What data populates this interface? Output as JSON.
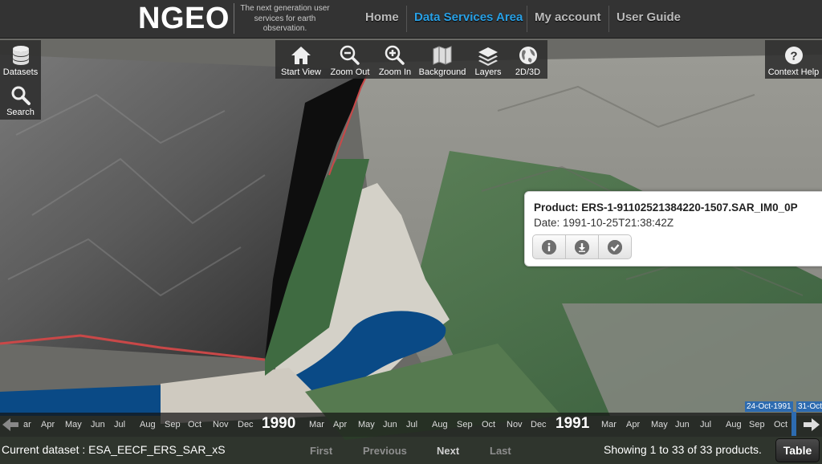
{
  "header": {
    "logo": "NGEO",
    "tagline": "The next generation user services for earth observation.",
    "nav": [
      {
        "label": "Home",
        "icon": "home"
      },
      {
        "label": "Data Services Area",
        "active": true
      },
      {
        "label": "My account"
      },
      {
        "label": "User Guide"
      }
    ]
  },
  "left_toolbar": [
    {
      "label": "Datasets",
      "icon": "database-icon"
    },
    {
      "label": "Search",
      "icon": "search-icon"
    }
  ],
  "map_toolbar": [
    {
      "label": "Start View",
      "icon": "home-icon"
    },
    {
      "label": "Zoom Out",
      "icon": "zoom-out-icon"
    },
    {
      "label": "Zoom In",
      "icon": "zoom-in-icon"
    },
    {
      "label": "Background",
      "icon": "map-icon"
    },
    {
      "label": "Layers",
      "icon": "layers-icon"
    },
    {
      "label": "2D/3D",
      "icon": "globe-icon"
    }
  ],
  "help": {
    "label": "Context Help",
    "icon": "help-icon"
  },
  "popup": {
    "product": "Product: ERS-1-91102521384220-1507.SAR_IM0_0P",
    "date": "Date: 1991-10-25T21:38:42Z",
    "actions": [
      {
        "name": "info",
        "icon": "info-icon"
      },
      {
        "name": "download",
        "icon": "download-icon"
      },
      {
        "name": "select",
        "icon": "check-icon"
      }
    ]
  },
  "timeline": {
    "labels": [
      "ar",
      "Apr",
      "May",
      "Jun",
      "Jul",
      "Aug",
      "Sep",
      "Oct",
      "Nov",
      "Dec",
      "1990",
      "Mar",
      "Apr",
      "May",
      "Jun",
      "Jul",
      "Aug",
      "Sep",
      "Oct",
      "Nov",
      "Dec",
      "1991",
      "Mar",
      "Apr",
      "May",
      "Jun",
      "Jul",
      "Aug",
      "Sep",
      "Oct"
    ],
    "range_start": "24-Oct-1991",
    "range_end": "31-Oct",
    "accent": "#2d6bb0"
  },
  "status": {
    "current_dataset": "Current dataset : ESA_EECF_ERS_SAR_xS",
    "pager": {
      "first": "First",
      "previous": "Previous",
      "next": "Next",
      "last": "Last"
    },
    "showing": "Showing 1 to 33 of 33 products.",
    "table_label": "Table"
  },
  "colors": {
    "header_bg": "#333333",
    "active_nav": "#29a1e6",
    "water": "#0a4a86"
  }
}
